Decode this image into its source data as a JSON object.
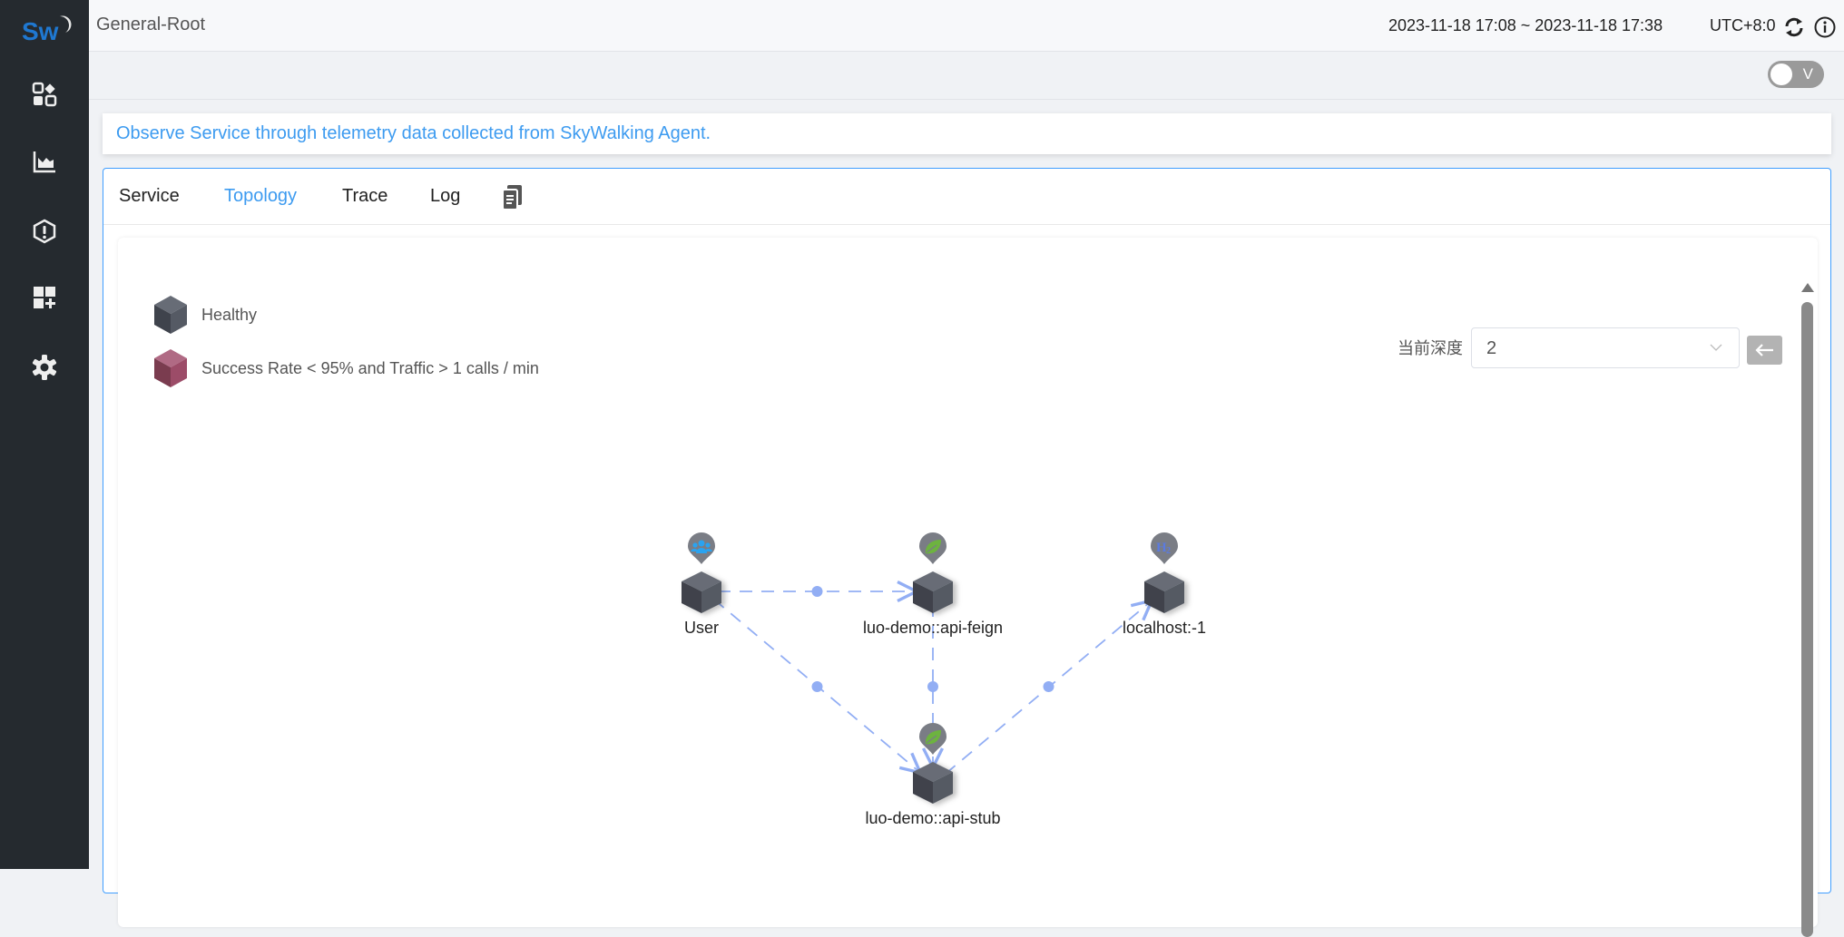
{
  "sidebar": {
    "logo": "Sw",
    "items": [
      {
        "icon": "dashboard-icon"
      },
      {
        "icon": "area-chart-icon"
      },
      {
        "icon": "alarm-icon"
      },
      {
        "icon": "add-widget-icon"
      },
      {
        "icon": "gear-icon"
      }
    ]
  },
  "header": {
    "title": "General-Root",
    "time_range": "2023-11-18 17:08 ~ 2023-11-18 17:38",
    "timezone": "UTC+8:0"
  },
  "toolbar": {
    "toggle_label": "V",
    "toggle_on": false
  },
  "description": "Observe Service through telemetry data collected from SkyWalking Agent.",
  "tabs": [
    {
      "label": "Service",
      "active": false
    },
    {
      "label": "Topology",
      "active": true
    },
    {
      "label": "Trace",
      "active": false
    },
    {
      "label": "Log",
      "active": false
    }
  ],
  "legend": [
    {
      "label": "Healthy",
      "color": "#4d525c"
    },
    {
      "label": "Success Rate < 95% and Traffic > 1 calls / min",
      "color": "#9c4c68"
    }
  ],
  "depth": {
    "label": "当前深度",
    "value": "2"
  },
  "colors": {
    "accent": "#3d9bf0",
    "edge": "#92aef4",
    "node": "#4d525c"
  },
  "topology": {
    "nodes": [
      {
        "id": "user",
        "name": "User",
        "icon": "users-icon"
      },
      {
        "id": "feign",
        "name": "luo-demo::api-feign",
        "icon": "spring-leaf-icon"
      },
      {
        "id": "h2",
        "name": "localhost:-1",
        "icon": "h2-database-icon"
      },
      {
        "id": "stub",
        "name": "luo-demo::api-stub",
        "icon": "spring-leaf-icon"
      }
    ],
    "edges": [
      {
        "source": "user",
        "target": "feign"
      },
      {
        "source": "user",
        "target": "stub"
      },
      {
        "source": "feign",
        "target": "stub"
      },
      {
        "source": "stub",
        "target": "h2"
      }
    ]
  }
}
